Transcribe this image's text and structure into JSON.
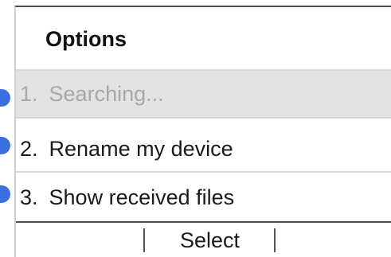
{
  "header": {
    "title": "Options"
  },
  "menu": {
    "items": [
      {
        "number": "1.",
        "label": "Searching...",
        "state": "disabled"
      },
      {
        "number": "2.",
        "label": "Rename my device",
        "state": "enabled"
      },
      {
        "number": "3.",
        "label": "Show received files",
        "state": "enabled"
      }
    ]
  },
  "softkeys": {
    "center_label": "Select"
  },
  "colors": {
    "marker": "#3a6fe0",
    "highlight_row": "#e3e3e3",
    "disabled_text": "#a8a8a8"
  }
}
